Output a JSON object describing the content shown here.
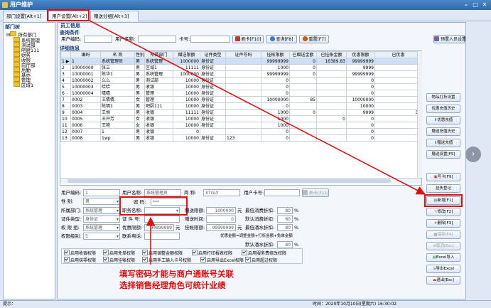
{
  "window": {
    "title": "用户维护"
  },
  "tabs": [
    {
      "label": "部门设置[Alt+1]"
    },
    {
      "label": "用户设置[Alt+2]"
    },
    {
      "label": "赠送分组[Alt+3]"
    }
  ],
  "dept_tree": {
    "title": "部门树",
    "root": "所有部门",
    "items": [
      "系统管理",
      "测试部",
      "吧厨111",
      "财务",
      "收银",
      "前厅部",
      "后勤",
      "基办",
      "管理",
      "区域1"
    ]
  },
  "staff_panel": {
    "title": "员工信息"
  },
  "query": {
    "title": "查询条件",
    "user_no_label": "用户编码:",
    "user_name_label": "用户名称:",
    "card_label": "卡号:",
    "read_card_btn": "刷卡[F10]",
    "query_btn": "查询[F8]",
    "reset_btn": "重置[F7]",
    "preset_btn": "预置人员设置"
  },
  "detail": {
    "title": "详细信息",
    "columns": [
      "",
      "编码",
      "名 称",
      "性别",
      "所属部门",
      "赠送限额",
      "证件类型",
      "证件号码",
      "挂帐限额",
      "已赠送金额",
      "已挂帐金额",
      "优惠限额",
      "已优惠"
    ],
    "rows": [
      [
        "1 ▶",
        "1",
        "系统管理员",
        "男",
        "系统管理",
        "1000000",
        "身份证",
        "",
        "99999999",
        "0",
        "16389.83",
        "99999999",
        ""
      ],
      [
        "2",
        "10000000",
        "张三",
        "男",
        "区域1",
        "11111",
        "身份证",
        "",
        "1000",
        "0",
        "",
        "9999",
        ""
      ],
      [
        "3",
        "10000001",
        "陈华1",
        "男",
        "系统管理",
        "1000000",
        "身份证",
        "",
        "99999999",
        "0",
        "",
        "99999999",
        ""
      ],
      [
        "4",
        "10000002",
        "么么",
        "男",
        "测试部",
        "10000",
        "身份证",
        "",
        "0",
        "",
        "",
        "0",
        ""
      ],
      [
        "5",
        "10000003",
        "哈哈",
        "男",
        "收银",
        "10000",
        "身份证",
        "",
        "0",
        "",
        "",
        "0",
        ""
      ],
      [
        "6",
        "10000004",
        "嘻嘻",
        "男",
        "管理",
        "10000",
        "身份证",
        "",
        "0",
        "",
        "",
        "0",
        ""
      ],
      [
        "7",
        "0002",
        "王倩倩",
        "女",
        "管理",
        "10000",
        "身份证",
        "",
        "10000000",
        "85",
        "",
        "10000000",
        ""
      ],
      [
        "8",
        "0003",
        "陈明1",
        "男",
        "吧厨111",
        "10000",
        "身份证",
        "",
        "0",
        "",
        "",
        "10000",
        ""
      ],
      [
        "9",
        "0004",
        "王恒",
        "男",
        "收银",
        "11111",
        "身份证",
        "",
        "1000",
        "0",
        "",
        "9999",
        "39"
      ],
      [
        "10",
        "0005",
        "王开芳",
        "女",
        "收银",
        "10000",
        "身份证",
        "",
        "1000",
        "",
        "0",
        "0",
        ""
      ],
      [
        "11",
        "0006",
        "王艳",
        "女",
        "收银",
        "10000",
        "身份证",
        "",
        "1000",
        "",
        "",
        "0",
        ""
      ],
      [
        "12",
        "0007",
        "1",
        "男",
        "收银",
        "0",
        "",
        "",
        "0",
        "",
        "",
        "0",
        ""
      ],
      [
        "13",
        "0008",
        "1wp",
        "男",
        "收银",
        "10000",
        "身份证",
        "123",
        "0",
        "",
        "",
        "0",
        ""
      ]
    ]
  },
  "form": {
    "user_no_label": "用户编码:",
    "user_no_value": "1",
    "user_name_label": "用户名称:",
    "user_name_value": "系统管理员",
    "short_label": "简 称:",
    "short_value": "XTGLY",
    "card_label": "用户卡号:",
    "card_btn": "刷卡[F11]",
    "gender_label": "性 别:",
    "gender_value": "男",
    "password_label": "密 码:",
    "password_value": "***",
    "dept_label": "所属部门:",
    "dept_value": "系统管理",
    "role_label": "职务名称:",
    "role_value": "",
    "gift_limit_label": "赠送限额:",
    "gift_limit_value": "1000000",
    "gift_unit": "元",
    "min_cost_discount_label": "最低消费折扣:",
    "min_cost_discount_value": "80",
    "cert_type_label": "证件类型:",
    "cert_type_value": "身份证",
    "cert_no_label": "证 件 号:",
    "gift_hours_label": "赠送时间:",
    "gift_hours_value": "0",
    "default_cost_discount_label": "默认消费折扣:",
    "default_cost_discount_value": "80",
    "right_group_label": "权 限 组:",
    "right_group_value": "系统管理",
    "discount_limit_label": "优惠限额:",
    "discount_limit_value": "99999999",
    "discount_unit": "元",
    "credit_limit_label": "挂帐限额:",
    "credit_limit_value": "99999999",
    "credit_unit": "元",
    "min_drink_discount_label": "最低酒水折扣:",
    "min_drink_discount_value": "80",
    "right_level_label": "权限级别:",
    "right_level_value": "5",
    "contact_label": "联系电话:",
    "default_drink_discount_label": "默认酒水折扣:",
    "default_drink_discount_value": "80",
    "percent": "%",
    "formula_note": "优惠金额=调整金额+打折金额+免单金额"
  },
  "checkboxes": [
    [
      "启用收银权限",
      "启用免单权限",
      "启用调整金额权限",
      "启用打印报表权限",
      "启用服务费修改权限"
    ],
    [
      "启用抹零权限",
      "启用挂帐权限",
      "启用手工输入卡号权限",
      "启用导出Excel权限",
      "启用超过权限"
    ]
  ],
  "side_buttons": {
    "top": [
      "物品打折设置",
      "优惠充值历史",
      "优惠充值",
      "赠送充值历史",
      "赠送充值",
      "赠送设置[F5]"
    ],
    "bottom": [
      "写卡[F9]",
      "挂失登记",
      "新增[F1]",
      "修改[F2]",
      "删除[F3]",
      "保存[F4]",
      "取消[Esc]",
      "Excel导入",
      "导出Excel",
      "退出[Esc]"
    ]
  },
  "annotation": {
    "line1": "填写密码才能与商户通账号关联",
    "line2": "选择销售经理角色可统计业绩"
  },
  "statusbar": {
    "left": "提示：",
    "time": "时间：2020年10月10日(星期六) 16:30:02"
  },
  "colors": {
    "accent": "#2f6aaa",
    "highlight": "#e01010",
    "selected_row": "#cfe0f5"
  }
}
